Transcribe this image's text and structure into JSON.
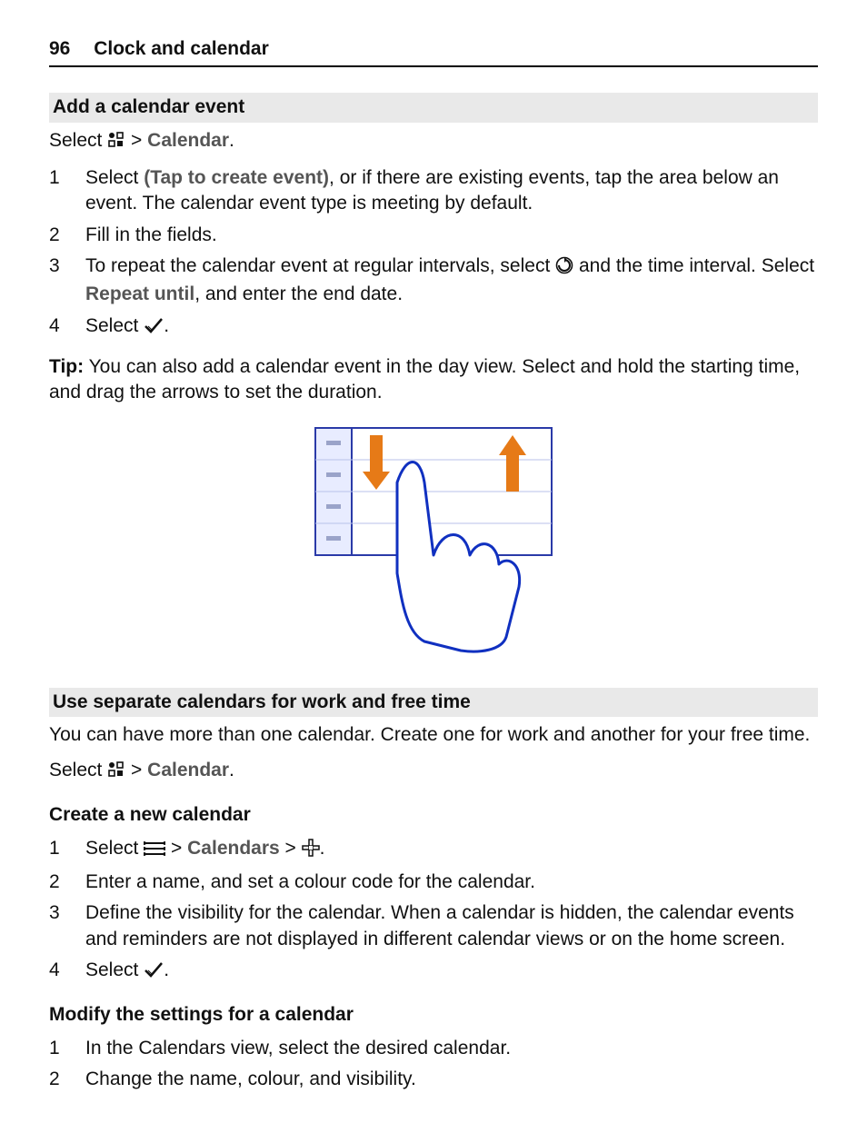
{
  "header": {
    "page_number": "96",
    "chapter_title": "Clock and calendar"
  },
  "section1": {
    "heading": "Add a calendar event",
    "intro_select": "Select ",
    "intro_gt": " > ",
    "intro_calendar": "Calendar",
    "intro_period": ".",
    "steps": [
      {
        "num": "1",
        "pre": "Select ",
        "bold": "(Tap to create event)",
        "post": ", or if there are existing events, tap the area below an event. The calendar event type is meeting by default."
      },
      {
        "num": "2",
        "text": "Fill in the fields."
      },
      {
        "num": "3",
        "pre": "To repeat the calendar event at regular intervals, select ",
        "mid": " and the time interval. Select ",
        "bold": "Repeat until",
        "post": ", and enter the end date."
      },
      {
        "num": "4",
        "pre": "Select ",
        "post": "."
      }
    ],
    "tip_label": "Tip:",
    "tip_text": " You can also add a calendar event in the day view. Select and hold the starting time, and drag the arrows to set the duration."
  },
  "section2": {
    "heading": "Use separate calendars for work and free time",
    "intro": "You can have more than one calendar. Create one for work and another for your free time.",
    "select_line_select": "Select ",
    "select_line_gt": " > ",
    "select_line_calendar": "Calendar",
    "select_line_period": ".",
    "create_heading": "Create a new calendar",
    "create_steps": [
      {
        "num": "1",
        "pre": "Select ",
        "gt1": " > ",
        "bold": "Calendars",
        "gt2": " > ",
        "post": "."
      },
      {
        "num": "2",
        "text": "Enter a name, and set a colour code for the calendar."
      },
      {
        "num": "3",
        "text": "Define the visibility for the calendar. When a calendar is hidden, the calendar events and reminders are not displayed in different calendar views or on the home screen."
      },
      {
        "num": "4",
        "pre": "Select ",
        "post": "."
      }
    ],
    "modify_heading": "Modify the settings for a calendar",
    "modify_steps": [
      {
        "num": "1",
        "text": "In the Calendars view, select the desired calendar."
      },
      {
        "num": "2",
        "text": "Change the name, colour, and visibility."
      }
    ]
  }
}
